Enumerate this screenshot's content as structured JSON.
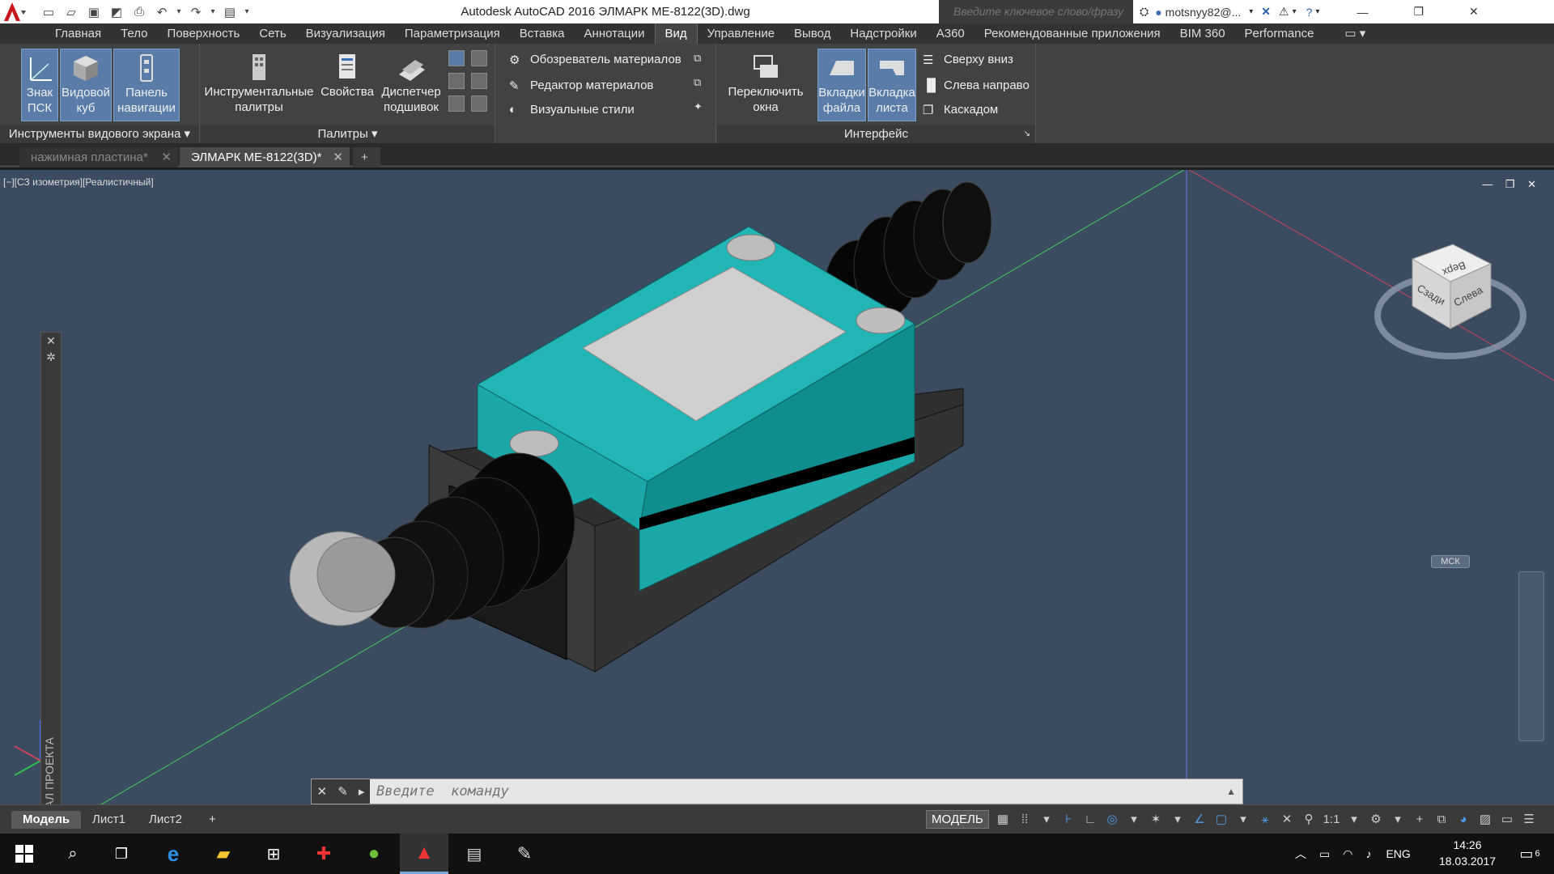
{
  "window": {
    "title": "Autodesk AutoCAD 2016    ЭЛМАРК МЕ-8122(3D).dwg",
    "search_placeholder": "Введите ключевое слово/фразу",
    "user": "motsnyy82@..."
  },
  "ribbon_tabs": [
    "Главная",
    "Тело",
    "Поверхность",
    "Сеть",
    "Визуализация",
    "Параметризация",
    "Вставка",
    "Аннотации",
    "Вид",
    "Управление",
    "Вывод",
    "Надстройки",
    "А360",
    "Рекомендованные приложения",
    "BIM 360",
    "Performance"
  ],
  "active_tab": "Вид",
  "panels": {
    "viewport_tools": {
      "label": "Инструменты видового экрана",
      "btn1": [
        "Знак",
        "ПСК"
      ],
      "btn2": [
        "Видовой",
        "куб"
      ],
      "btn3": [
        "Панель",
        "навигации"
      ]
    },
    "palettes": {
      "label": "Палитры",
      "btn1": [
        "Инструментальные",
        "палитры"
      ],
      "btn2": [
        "Свойства",
        ""
      ],
      "btn3": [
        "Диспетчер",
        "подшивок"
      ]
    },
    "materials": {
      "item1": "Обозреватель материалов",
      "item2": "Редактор материалов",
      "item3": "Визуальные  стили"
    },
    "interface": {
      "label": "Интерфейс",
      "btn1": [
        "Переключить",
        "окна"
      ],
      "btn2": [
        "Вкладки",
        "файла"
      ],
      "btn3": [
        "Вкладка",
        "листа"
      ],
      "item1": "Сверху вниз",
      "item2": "Слева направо",
      "item3": "Каскадом"
    }
  },
  "doc_tabs": [
    "нажимная пластина*",
    "ЭЛМАРК МЕ-8122(3D)*"
  ],
  "viewport": {
    "label": "[−][СЗ изометрия][Реалистичный]",
    "project_channel": "КАНАЛ ПРОЕКТА",
    "viewcube": {
      "top": "Верх",
      "back": "Сзади",
      "left": "Слева",
      "wcs": "МСК"
    }
  },
  "command": {
    "placeholder": "Введите  команду"
  },
  "layouts": [
    "Модель",
    "Лист1",
    "Лист2"
  ],
  "status": {
    "model": "МОДЕЛЬ",
    "scale": "1:1"
  },
  "taskbar": {
    "lang": "ENG",
    "time": "14:26",
    "date": "18.03.2017",
    "notif": "6"
  },
  "colors": {
    "accent": "#5a7ca8",
    "body_teal": "#18a3a3",
    "viewport": "#3c4c60"
  }
}
